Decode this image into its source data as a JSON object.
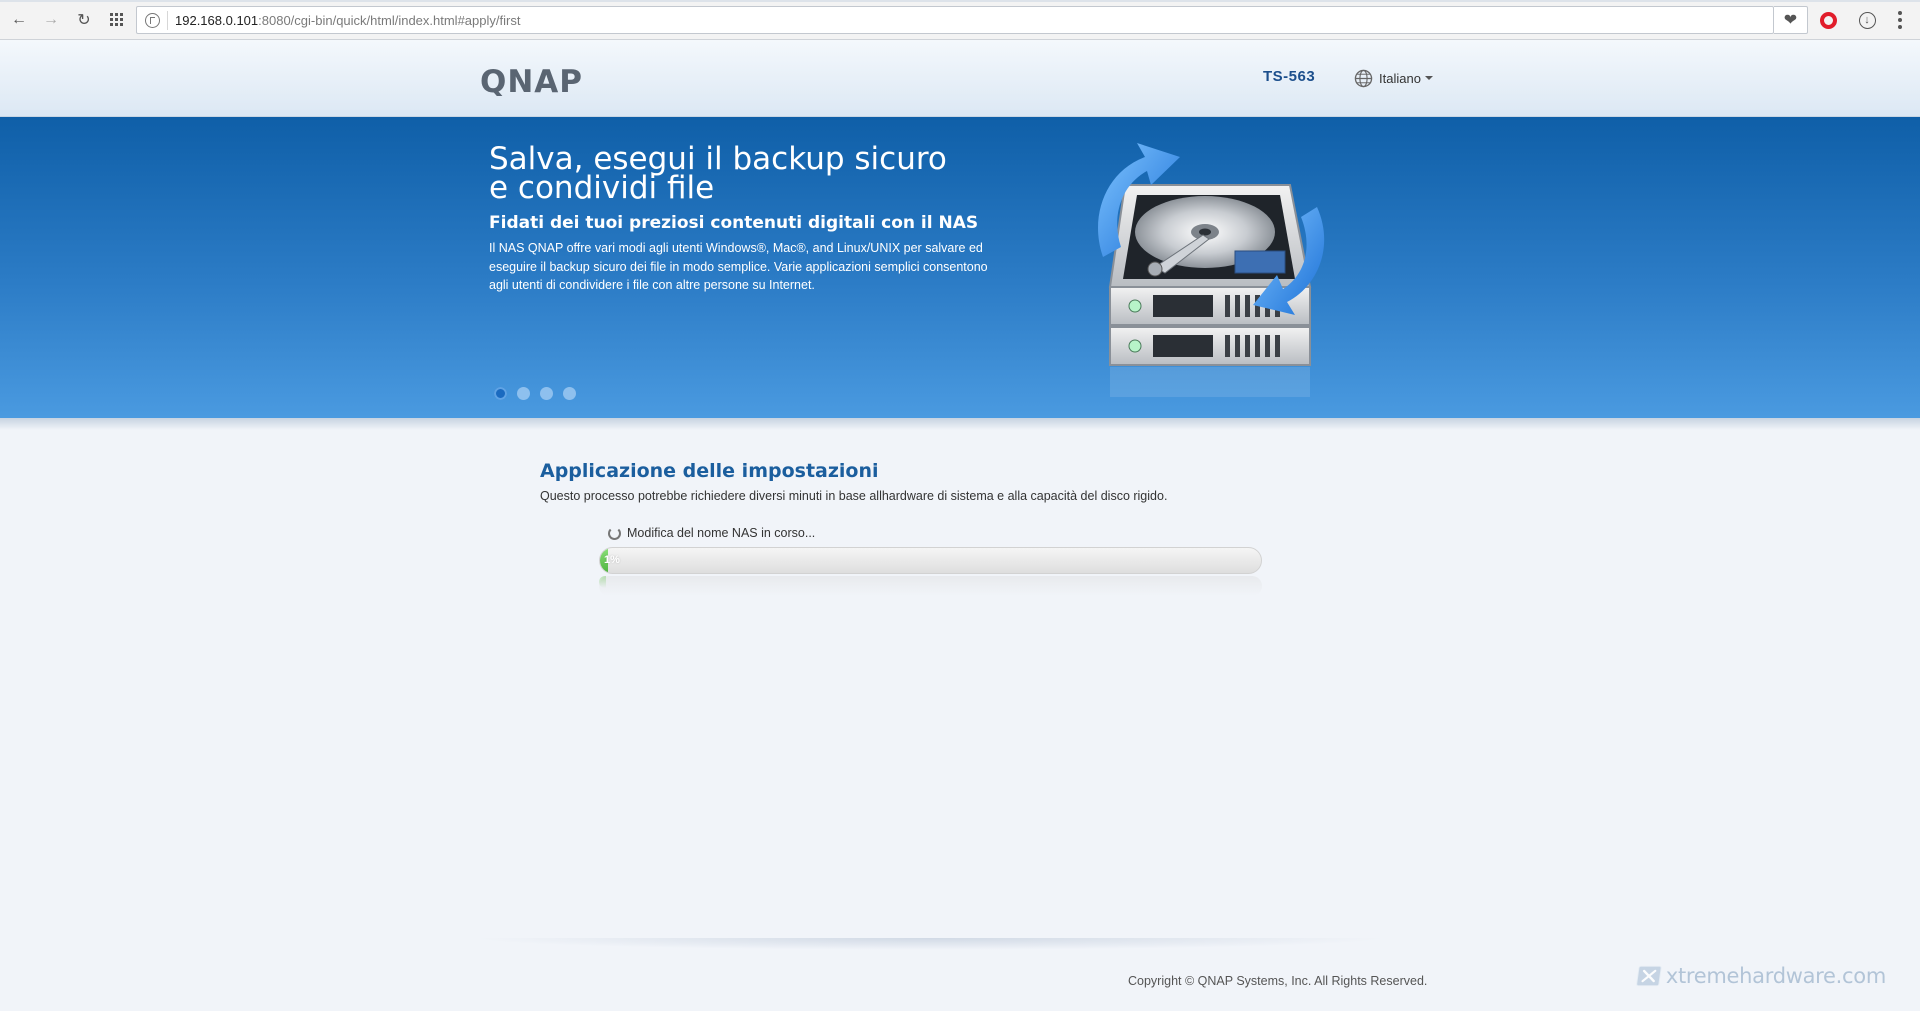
{
  "browser": {
    "url_host": "192.168.0.101",
    "url_rest": ":8080/cgi-bin/quick/html/index.html#apply/first"
  },
  "header": {
    "logo_text": "QNAP",
    "model": "TS-563",
    "language": "Italiano"
  },
  "banner": {
    "title_line1": "Salva, esegui il backup sicuro",
    "title_line2": "e condividi file",
    "subtitle": "Fidati dei tuoi preziosi contenuti digitali con il NAS",
    "text": "Il NAS QNAP offre vari modi agli utenti Windows®, Mac®, and Linux/UNIX per salvare ed eseguire il backup sicuro dei file in modo semplice. Varie applicazioni semplici consentono agli utenti di condividere i file con altre persone su Internet.",
    "active_slide": 1,
    "slide_count": 4
  },
  "main": {
    "title": "Applicazione delle impostazioni",
    "description": "Questo processo potrebbe richiedere diversi minuti in base allhardware di sistema e alla capacità del disco rigido.",
    "status": "Modifica del nome NAS in corso...",
    "progress_label": "1%",
    "progress_fraction": 0.01
  },
  "footer": {
    "copyright": "Copyright © QNAP Systems, Inc. All Rights Reserved."
  },
  "watermark": {
    "text": "xtremehardware.com"
  },
  "colors": {
    "brand_blue": "#1b5e9e",
    "progress_green": "#4fb43f",
    "opera_red": "#e11d2b"
  }
}
